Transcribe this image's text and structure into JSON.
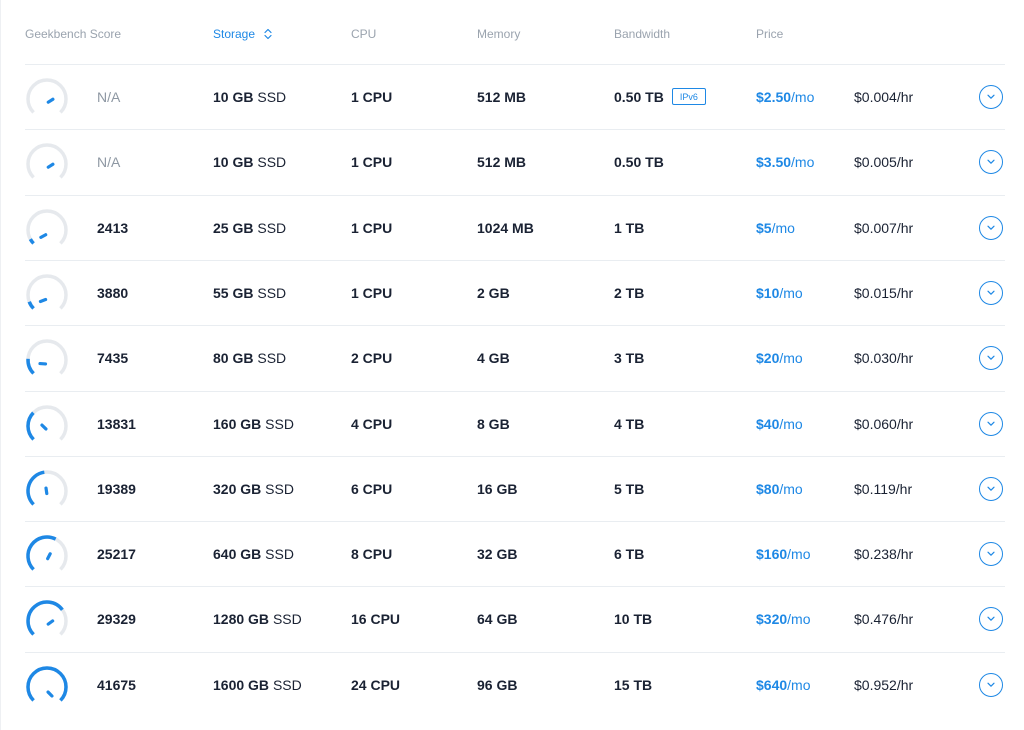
{
  "headers": {
    "score": "Geekbench Score",
    "storage": "Storage",
    "cpu": "CPU",
    "memory": "Memory",
    "bandwidth": "Bandwidth",
    "price": "Price"
  },
  "sort": {
    "column": "storage",
    "icon": "sort-updown-icon"
  },
  "colors": {
    "accent": "#1e88e5",
    "muted": "#9aa3ae",
    "text": "#1a2233",
    "gauge_track": "#e6e9ed"
  },
  "plans": [
    {
      "score": "N/A",
      "gauge": 0.0,
      "storage_num": "10 GB",
      "storage_unit": "SSD",
      "cpu": "1 CPU",
      "memory": "512 MB",
      "bandwidth": "0.50 TB",
      "badge": "IPv6",
      "price_num": "$2.50",
      "price_unit": "/mo",
      "hourly": "$0.004/hr"
    },
    {
      "score": "N/A",
      "gauge": 0.0,
      "storage_num": "10 GB",
      "storage_unit": "SSD",
      "cpu": "1 CPU",
      "memory": "512 MB",
      "bandwidth": "0.50 TB",
      "badge": "",
      "price_num": "$3.50",
      "price_unit": "/mo",
      "hourly": "$0.005/hr"
    },
    {
      "score": "2413",
      "gauge": 0.06,
      "storage_num": "25 GB",
      "storage_unit": "SSD",
      "cpu": "1 CPU",
      "memory": "1024 MB",
      "bandwidth": "1 TB",
      "badge": "",
      "price_num": "$5",
      "price_unit": "/mo",
      "hourly": "$0.007/hr"
    },
    {
      "score": "3880",
      "gauge": 0.09,
      "storage_num": "55 GB",
      "storage_unit": "SSD",
      "cpu": "1 CPU",
      "memory": "2 GB",
      "bandwidth": "2 TB",
      "badge": "",
      "price_num": "$10",
      "price_unit": "/mo",
      "hourly": "$0.015/hr"
    },
    {
      "score": "7435",
      "gauge": 0.18,
      "storage_num": "80 GB",
      "storage_unit": "SSD",
      "cpu": "2 CPU",
      "memory": "4 GB",
      "bandwidth": "3 TB",
      "badge": "",
      "price_num": "$20",
      "price_unit": "/mo",
      "hourly": "$0.030/hr"
    },
    {
      "score": "13831",
      "gauge": 0.33,
      "storage_num": "160 GB",
      "storage_unit": "SSD",
      "cpu": "4 CPU",
      "memory": "8 GB",
      "bandwidth": "4 TB",
      "badge": "",
      "price_num": "$40",
      "price_unit": "/mo",
      "hourly": "$0.060/hr"
    },
    {
      "score": "19389",
      "gauge": 0.47,
      "storage_num": "320 GB",
      "storage_unit": "SSD",
      "cpu": "6 CPU",
      "memory": "16 GB",
      "bandwidth": "5 TB",
      "badge": "",
      "price_num": "$80",
      "price_unit": "/mo",
      "hourly": "$0.119/hr"
    },
    {
      "score": "25217",
      "gauge": 0.6,
      "storage_num": "640 GB",
      "storage_unit": "SSD",
      "cpu": "8 CPU",
      "memory": "32 GB",
      "bandwidth": "6 TB",
      "badge": "",
      "price_num": "$160",
      "price_unit": "/mo",
      "hourly": "$0.238/hr"
    },
    {
      "score": "29329",
      "gauge": 0.7,
      "storage_num": "1280 GB",
      "storage_unit": "SSD",
      "cpu": "16 CPU",
      "memory": "64 GB",
      "bandwidth": "10 TB",
      "badge": "",
      "price_num": "$320",
      "price_unit": "/mo",
      "hourly": "$0.476/hr"
    },
    {
      "score": "41675",
      "gauge": 1.0,
      "storage_num": "1600 GB",
      "storage_unit": "SSD",
      "cpu": "24 CPU",
      "memory": "96 GB",
      "bandwidth": "15 TB",
      "badge": "",
      "price_num": "$640",
      "price_unit": "/mo",
      "hourly": "$0.952/hr"
    }
  ],
  "row_action_icon": "chevron-down-icon"
}
